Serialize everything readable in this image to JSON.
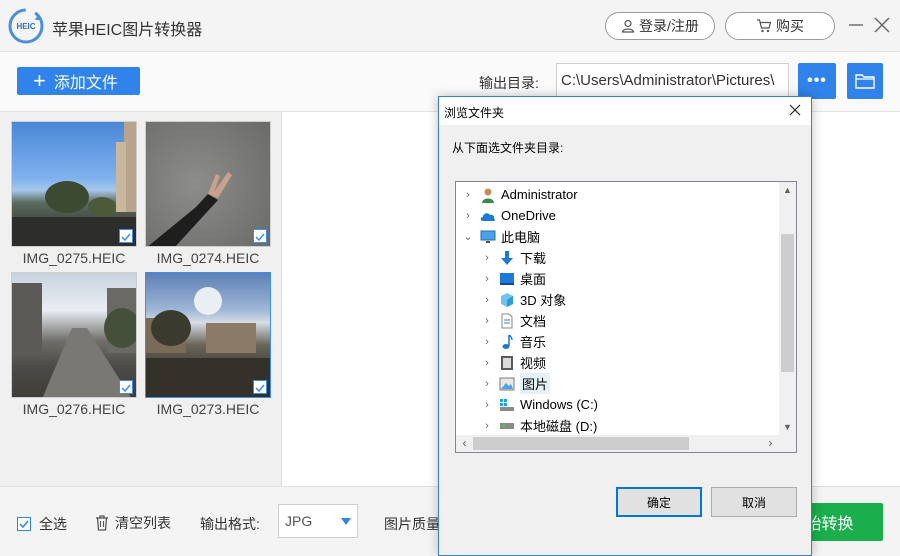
{
  "app": {
    "title": "苹果HEIC图片转换器",
    "logo_text": "HEIC",
    "login_label": "登录/注册",
    "buy_label": "购买"
  },
  "toolbar": {
    "add_file_label": "添加文件",
    "output_dir_label": "输出目录:",
    "output_dir_value": "C:\\Users\\Administrator\\Pictures\\",
    "more_label": "•••"
  },
  "files": [
    {
      "name": "IMG_0275.HEIC",
      "checked": true
    },
    {
      "name": "IMG_0274.HEIC",
      "checked": true
    },
    {
      "name": "IMG_0276.HEIC",
      "checked": true
    },
    {
      "name": "IMG_0273.HEIC",
      "checked": true
    }
  ],
  "bottom": {
    "select_all_label": "全选",
    "clear_list_label": "清空列表",
    "format_label": "输出格式:",
    "format_value": "JPG",
    "quality_label": "图片质量",
    "start_label": "开始转换"
  },
  "dialog": {
    "title": "浏览文件夹",
    "prompt": "从下面选文件夹目录:",
    "tree": [
      {
        "label": "Administrator",
        "icon": "user-icon",
        "expander": "›"
      },
      {
        "label": "OneDrive",
        "icon": "cloud-icon",
        "expander": "›"
      },
      {
        "label": "此电脑",
        "icon": "computer-icon",
        "expander": "⌄"
      },
      {
        "label": "下载",
        "icon": "download-icon",
        "expander": "›"
      },
      {
        "label": "桌面",
        "icon": "desktop-icon",
        "expander": "›"
      },
      {
        "label": "3D 对象",
        "icon": "cube-icon",
        "expander": "›"
      },
      {
        "label": "文档",
        "icon": "document-icon",
        "expander": "›"
      },
      {
        "label": "音乐",
        "icon": "music-icon",
        "expander": "›"
      },
      {
        "label": "视频",
        "icon": "video-icon",
        "expander": "›"
      },
      {
        "label": "图片",
        "icon": "pictures-icon",
        "expander": "›"
      },
      {
        "label": "Windows (C:)",
        "icon": "drive-c-icon",
        "expander": "›"
      },
      {
        "label": "本地磁盘 (D:)",
        "icon": "drive-icon",
        "expander": "›"
      }
    ],
    "selected_index": 9,
    "ok_label": "确定",
    "cancel_label": "取消"
  },
  "colors": {
    "accent": "#2f83ea",
    "start": "#1aae4c",
    "dialog_border": "#3a7fd0"
  }
}
